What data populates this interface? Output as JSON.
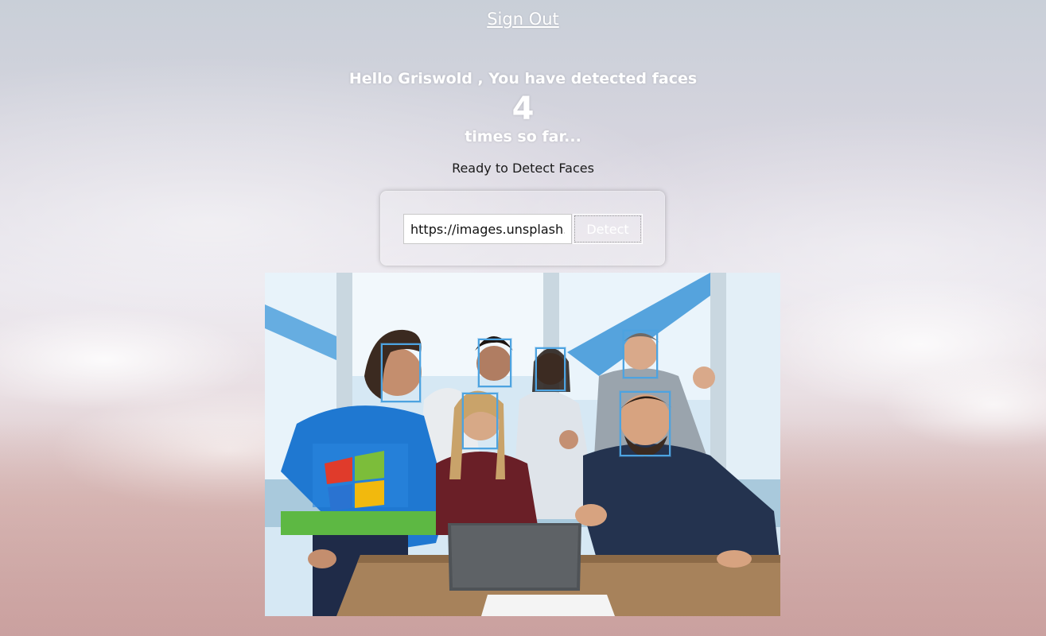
{
  "header": {
    "sign_out_label": "Sign Out"
  },
  "greeting": {
    "text": "Hello Griswold , You have detected faces",
    "count": "4",
    "suffix": "times so far..."
  },
  "status": {
    "text": "Ready to Detect Faces"
  },
  "form": {
    "url_value": "https://images.unsplash.com/",
    "detect_label": "Detect"
  },
  "image": {
    "face_boxes_detected": 6
  },
  "colors": {
    "face_box": "#4da3e0",
    "text_light": "#ffffff",
    "text_dark": "#1a1a1a"
  }
}
